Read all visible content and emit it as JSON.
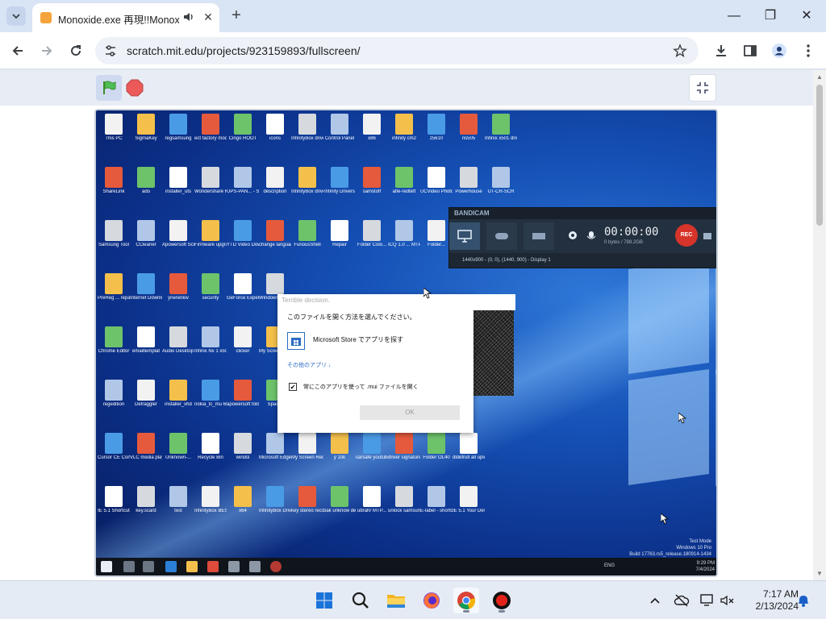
{
  "browser": {
    "tab_title": "Monoxide.exe 再現!!Monox",
    "url": "scratch.mit.edu/projects/923159893/fullscreen/"
  },
  "desktop": {
    "icons": [
      [
        "This PC",
        "SigmaKey",
        "regsamsung",
        "ect factory modes co...",
        "Cingo ROOT",
        "icons",
        "InfinityBox drivers in...",
        "Control Panel",
        "x86",
        "infinity cm2",
        "z5610",
        "ris505",
        "Infinix x501 drivers Fo..."
      ],
      [
        "ShareLink",
        "ado",
        "installer_uts",
        "Wondershare Filmora9",
        "UPS-PAN... - Shortcut",
        "description",
        "InfinityBox drivers in...",
        "Infinity Drivers",
        "samstoff",
        "alfe-redteft",
        "UCVideo Photo Voyag...",
        "Powerhouse",
        "UT-CR-SCR"
      ],
      [
        "Samsung Tool",
        "CCleaner",
        "Apowersoft Screen Rec...",
        "Firmware upgrade e...",
        "YTD Video Downloader",
        "change language ...",
        "FuriousShell",
        "Repair",
        "Folder Colo...",
        "ICQ 1.0 ... MTP Rec...",
        "Folder..."
      ],
      [
        "PreReg ... repair",
        "Internet Downlo...",
        "ynerenkiv",
        "security",
        "GeForce Experience",
        "Windows Update..."
      ],
      [
        "Chrome Editor",
        "emailtemplat",
        "Audio Desktop ...",
        "Infinix Nx 1 x501",
        "clicker",
        "My Screen Recor..."
      ],
      [
        "regedition",
        "Defraggler",
        "installer_vhd",
        "nokia_tc_mu 653",
        "apowersoft folder",
        "Spac..."
      ],
      [
        "Cursor CE Control...",
        "VLC media player",
        "Unknown-...",
        "Recycle Bin",
        "windsl",
        "Microsoft Edge",
        "My Screen Recorder P...",
        "y 10k",
        "carsafe youtube",
        "driver signature",
        "Folder OL40",
        "dldefrult all upload"
      ],
      [
        "IE 5.1 Shortcut",
        "key.scard",
        "test",
        "InfinityBox BEST",
        "x64",
        "InfinityBox Drivers",
        "key stereo recorder",
        "bak unknow device",
        "ubrahr MTP...",
        "unlock samsung ...",
        "E-label - shortcut",
        "IE 5.1 Your Device sen..."
      ]
    ]
  },
  "bandicam": {
    "title": "BANDICAM",
    "time": "00:00:00",
    "size": "0 bytes / 788.2GB",
    "rec": "REC",
    "info": "1440x900 - (0, 0), (1440, 900) - Display 1"
  },
  "dialog": {
    "title": "Terrible decision.",
    "heading": "このファイルを開く方法を選んでください。",
    "store": "Microsoft Store でアプリを探す",
    "more": "その他のアプリ ↓",
    "always": "常にこのアプリを使って .mui ファイルを開く",
    "ok": "OK"
  },
  "watermark": [
    "Test Mode",
    "Windows 10 Pro",
    "Build 17763.rs5_release.180914-1434"
  ],
  "inner_clock": [
    "9:29 PM",
    "7/4/2024"
  ],
  "inner_lang": "ENG",
  "clock": {
    "time": "7:17 AM",
    "date": "2/13/2024"
  }
}
